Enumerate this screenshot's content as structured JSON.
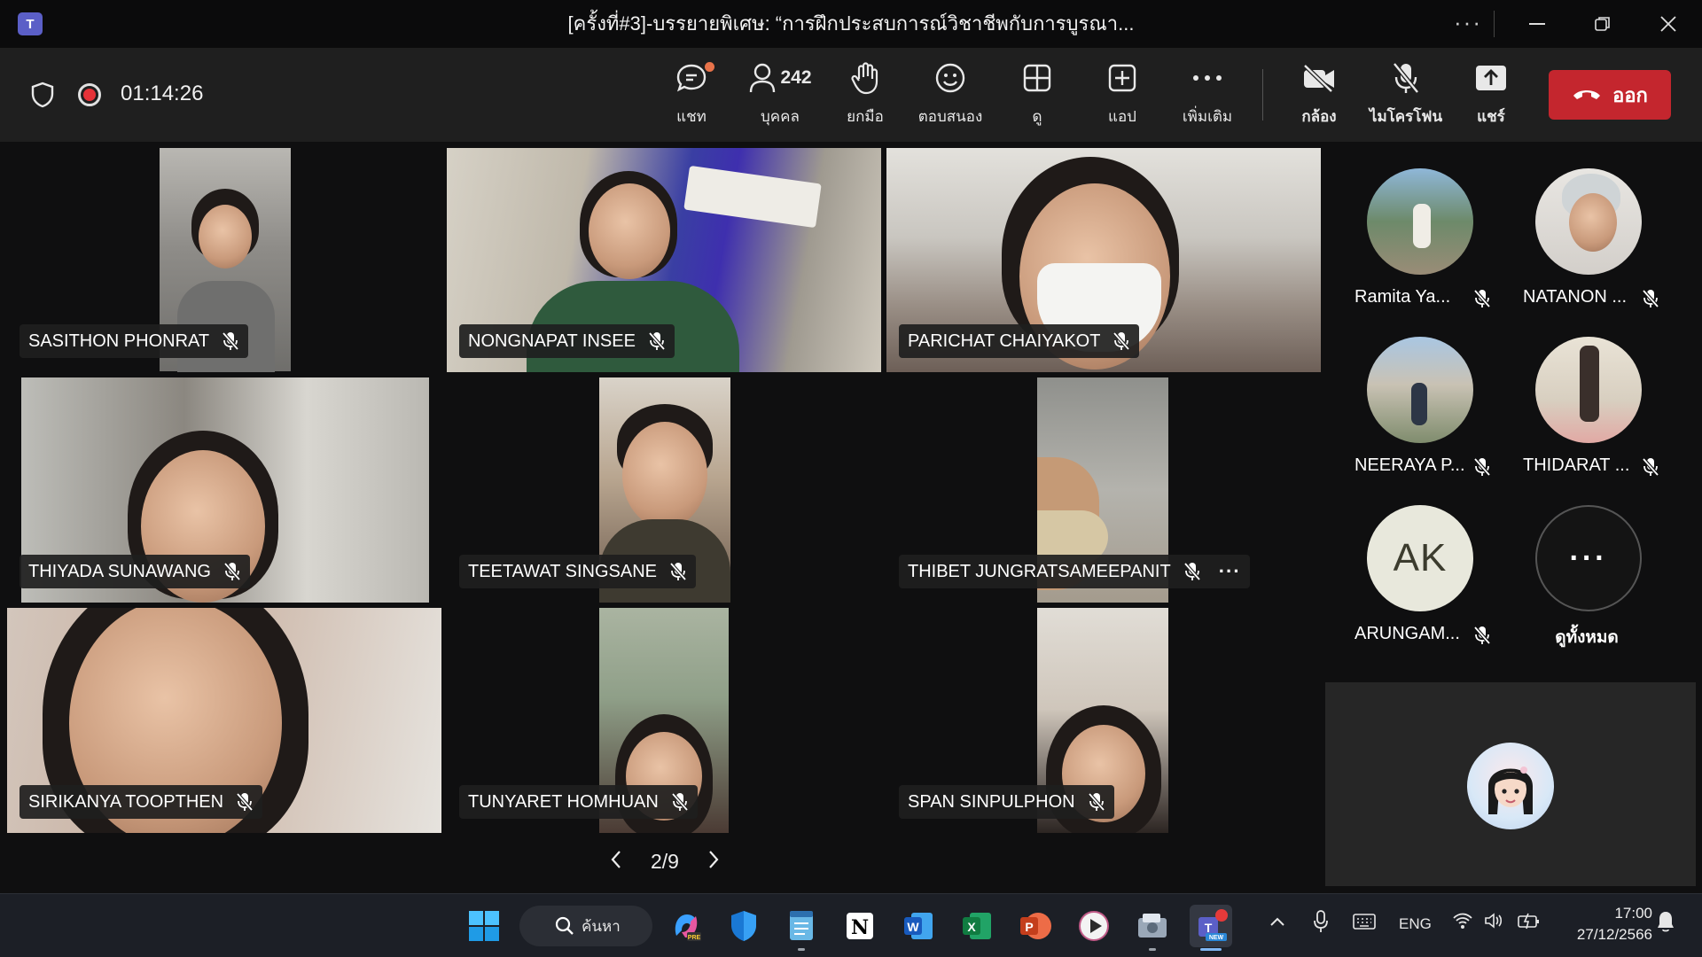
{
  "window": {
    "title": "[ครั้งที่#3]-บรรยายพิเศษ: “การฝึกประสบการณ์วิชาชีพกับการบูรณา...",
    "more": "···"
  },
  "toolbar": {
    "timer": "01:14:26",
    "chat": "แชท",
    "people_count": "242",
    "people": "บุคคล",
    "raise": "ยกมือ",
    "react": "ตอบสนอง",
    "view": "ดู",
    "apps": "แอป",
    "more": "เพิ่มเติม",
    "camera": "กล้อง",
    "mic": "ไมโครโฟน",
    "share": "แชร์",
    "leave": "ออก"
  },
  "participants": [
    {
      "name": "SASITHON PHONRAT"
    },
    {
      "name": "NONGNAPAT INSEE"
    },
    {
      "name": "PARICHAT CHAIYAKOT"
    },
    {
      "name": "THIYADA SUNAWANG"
    },
    {
      "name": "TEETAWAT SINGSANE"
    },
    {
      "name": "THIBET JUNGRATSAMEEPANIT"
    },
    {
      "name": "SIRIKANYA TOOPTHEN"
    },
    {
      "name": "TUNYARET HOMHUAN"
    },
    {
      "name": "SPAN SINPULPHON"
    }
  ],
  "pager": {
    "label": "2/9"
  },
  "roster": [
    {
      "name": "Ramita Ya..."
    },
    {
      "name": "NATANON ..."
    },
    {
      "name": "NEERAYA P..."
    },
    {
      "name": "THIDARAT ..."
    },
    {
      "name": "ARUNGAM...",
      "initials": "AK"
    }
  ],
  "view_all": {
    "label": "ดูทั้งหมด",
    "dots": "···"
  },
  "taskbar": {
    "search": "ค้นหา",
    "lang": "ENG",
    "time": "17:00",
    "date": "27/12/2566"
  },
  "colors": {
    "leave": "#c4262e",
    "teams": "#5b5fc7",
    "recording": "#e53238"
  }
}
